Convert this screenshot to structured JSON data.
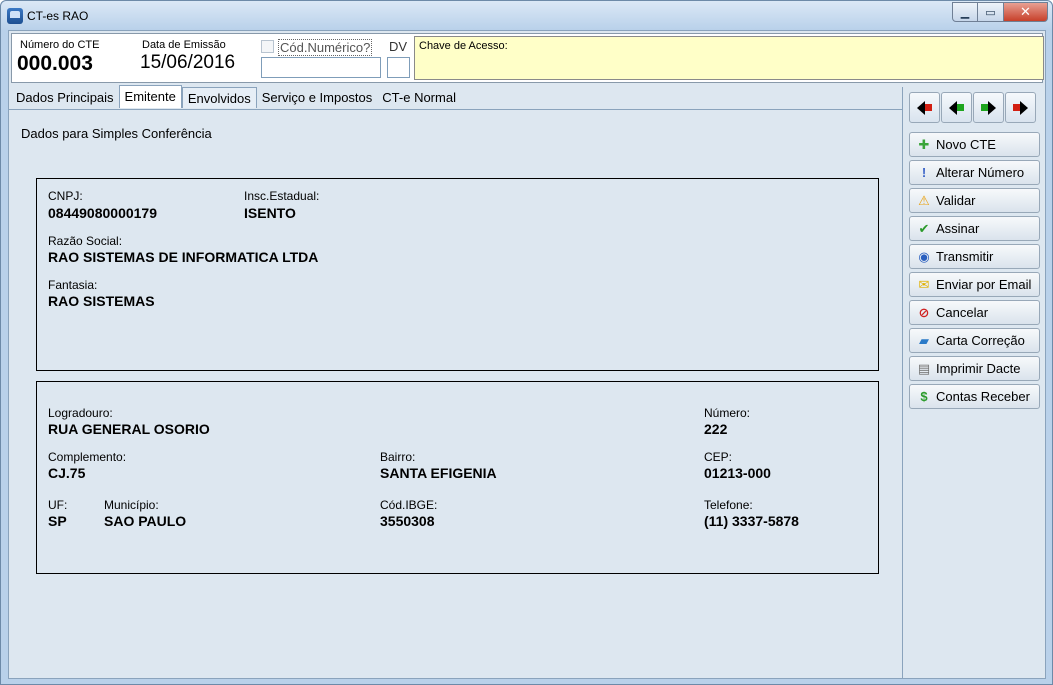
{
  "window": {
    "title": "CT-es RAO",
    "min_glyph": "▁",
    "max_glyph": "▭",
    "close_glyph": "✕"
  },
  "header": {
    "numero_label": "Número do CTE",
    "numero_value": "000.003",
    "data_label": "Data de Emissão",
    "data_value": "15/06/2016",
    "cod_numerico_label": "Cód.Numérico?",
    "cod_numerico_value": "",
    "dv_label": "DV",
    "dv_value": "",
    "chave_label": "Chave de Acesso:",
    "chave_value": ""
  },
  "tabs": [
    {
      "label": "Dados Principais"
    },
    {
      "label": "Emitente"
    },
    {
      "label": "Envolvidos"
    },
    {
      "label": "Serviço e Impostos"
    },
    {
      "label": "CT-e Normal"
    }
  ],
  "emitente": {
    "note": "Dados para Simples Conferência",
    "cnpj_label": "CNPJ:",
    "cnpj": "08449080000179",
    "ie_label": "Insc.Estadual:",
    "ie": "ISENTO",
    "razao_label": "Razão Social:",
    "razao": "RAO SISTEMAS DE INFORMATICA LTDA",
    "fantasia_label": "Fantasia:",
    "fantasia": "RAO SISTEMAS"
  },
  "endereco": {
    "logradouro_label": "Logradouro:",
    "logradouro": "RUA GENERAL OSORIO",
    "numero_label": "Número:",
    "numero": "222",
    "complemento_label": "Complemento:",
    "complemento": "CJ.75",
    "bairro_label": "Bairro:",
    "bairro": "SANTA EFIGENIA",
    "cep_label": "CEP:",
    "cep": "01213-000",
    "uf_label": "UF:",
    "uf": "SP",
    "municipio_label": "Município:",
    "municipio": "SAO PAULO",
    "ibge_label": "Cód.IBGE:",
    "ibge": "3550308",
    "telefone_label": "Telefone:",
    "telefone": "(11) 3337-5878"
  },
  "sidebar": {
    "nav": [
      "first-arrow",
      "prev-arrow",
      "next-arrow",
      "last-arrow"
    ],
    "actions": [
      {
        "label": "Novo CTE",
        "icon": "plus-icon",
        "glyph": "✚",
        "color": "#3aa53a"
      },
      {
        "label": "Alterar Número",
        "icon": "exclamation-icon",
        "glyph": "!",
        "color": "#3b64c8"
      },
      {
        "label": "Validar",
        "icon": "warning-icon",
        "glyph": "⚠",
        "color": "#e8a010"
      },
      {
        "label": "Assinar",
        "icon": "check-icon",
        "glyph": "✔",
        "color": "#2a9a2a"
      },
      {
        "label": "Transmitir",
        "icon": "globe-icon",
        "glyph": "◉",
        "color": "#2a5fbf"
      },
      {
        "label": "Enviar por Email",
        "icon": "envelope-icon",
        "glyph": "✉",
        "color": "#e0b000"
      },
      {
        "label": "Cancelar",
        "icon": "cancel-icon",
        "glyph": "⊘",
        "color": "#d02020"
      },
      {
        "label": "Carta Correção",
        "icon": "eraser-icon",
        "glyph": "▰",
        "color": "#2a7ac8"
      },
      {
        "label": "Imprimir Dacte",
        "icon": "printer-icon",
        "glyph": "▤",
        "color": "#707070"
      },
      {
        "label": "Contas Receber",
        "icon": "dollar-icon",
        "glyph": "$",
        "color": "#2a9a2a"
      }
    ]
  }
}
